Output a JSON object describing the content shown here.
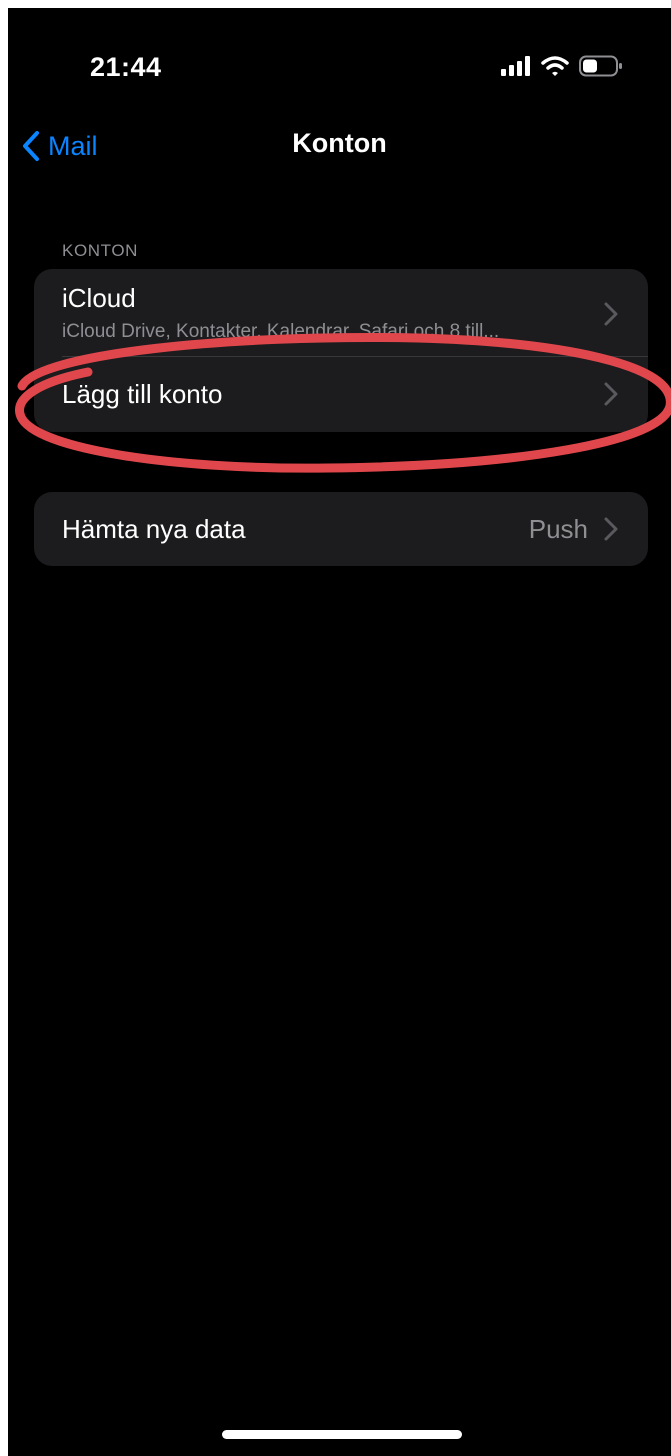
{
  "status_bar": {
    "time": "21:44",
    "icons": [
      "cellular-signal-icon",
      "wifi-icon",
      "battery-icon"
    ]
  },
  "nav": {
    "back_label": "Mail",
    "title": "Konton"
  },
  "accounts_section": {
    "header": "KONTON",
    "rows": [
      {
        "title": "iCloud",
        "subtitle": "iCloud Drive, Kontakter, Kalendrar, Safari och 8 till..."
      },
      {
        "title": "Lägg till konto"
      }
    ]
  },
  "fetch_section": {
    "title": "Hämta nya data",
    "value": "Push"
  },
  "colors": {
    "background": "#000000",
    "cell": "#1c1c1e",
    "accent": "#0a84ff",
    "secondary_text": "#8e8e93",
    "annotation": "#e0474c"
  }
}
